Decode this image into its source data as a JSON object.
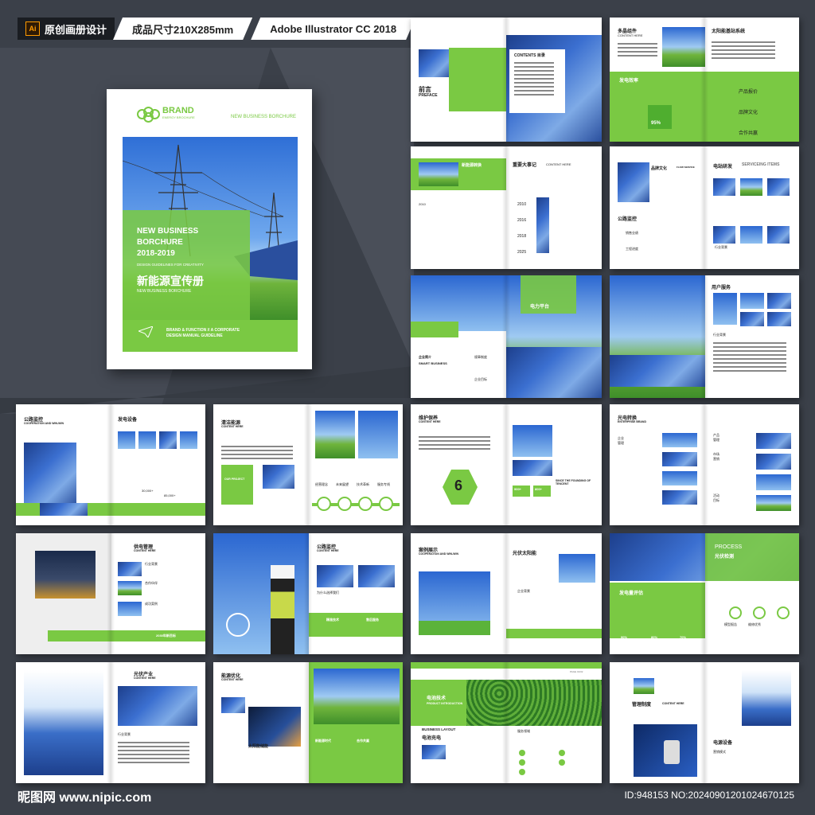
{
  "tags": {
    "software_badge": "Ai",
    "category": "原创画册设计",
    "size": "成品尺寸210X285mm",
    "software": "Adobe Illustrator CC 2018"
  },
  "cover": {
    "brand": "BRAND",
    "brand_sub": "ENERGY BROCHURE",
    "top_right": "NEW BUSINESS BORCHURE",
    "title_en_1": "NEW BUSINESS",
    "title_en_2": "BORCHURE",
    "years": "2018-2019",
    "guideline": "DESIGN GUIDELINES FOR CREATIVITY",
    "title_cn": "新能源宣传册",
    "title_cn_sub": "NEW BUSINESS BORCHURE",
    "function_1": "BRAND & FUNCTION // A CORPORATE",
    "function_2": "DESIGN MANUAL GUIDELINE"
  },
  "spreads": [
    {
      "id": "s1",
      "labels": [
        "前言",
        "PREFACE",
        "CONTENTS 目录"
      ]
    },
    {
      "id": "s2",
      "labels": [
        "多晶组件",
        "CONTENT HERE",
        "太阳能基站系统",
        "发电效率",
        "95%",
        "产品报价",
        "品牌文化",
        "合作共赢"
      ]
    },
    {
      "id": "s3",
      "labels": [
        "新能源转换",
        "重要大事记",
        "CONTENT HERE",
        "企业背景",
        "2010",
        "2016",
        "2018",
        "2025"
      ]
    },
    {
      "id": "s4",
      "labels": [
        "品牌文化",
        "FLOW SERVICE",
        "电站研发",
        "SERVICEING ITEMS",
        "公路监控",
        "行业背景",
        "销售业绩",
        "工程进度"
      ]
    },
    {
      "id": "s5",
      "labels": [
        "电力平台",
        "企业简介",
        "SMART BUSINESS",
        "规章制度",
        "企业目标"
      ]
    },
    {
      "id": "s6",
      "labels": [
        "用户服务",
        "行业背景"
      ]
    },
    {
      "id": "s7",
      "labels": [
        "公路监控",
        "COOPERATION AND WIN-WIN",
        "发电设备",
        "30,000+",
        "85,000+"
      ]
    },
    {
      "id": "s8",
      "labels": [
        "清洁能源",
        "CONTENT HERE",
        "OUR PROJECT",
        "经营理念",
        "未来展望",
        "技术革新",
        "服务专线"
      ]
    },
    {
      "id": "s9",
      "labels": [
        "维护保养",
        "CONTENT HERE",
        "6",
        "SINCE THE FOUNDING OF TENCENT",
        "900+",
        "800+"
      ]
    },
    {
      "id": "s10",
      "labels": [
        "光电转换",
        "ENTERPRISE BRAND",
        "企业管理",
        "产品管理",
        "市场营销",
        "活动目标"
      ]
    },
    {
      "id": "s11",
      "labels": [
        "供电管理",
        "CONTENT HERE",
        "行业背景",
        "合作伙伴",
        "成功案例",
        "2030年新目标"
      ]
    },
    {
      "id": "s12",
      "labels": [
        "公路监控",
        "CONTENT HERE",
        "产业发展",
        "为什么选择我们",
        "精准技术",
        "售后服务"
      ]
    },
    {
      "id": "s13",
      "labels": [
        "案例展示",
        "COOPERATION AND WIN-WIN",
        "光伏太阳能",
        "企业背景"
      ]
    },
    {
      "id": "s14",
      "labels": [
        "PROCESS",
        "光伏检测",
        "发电量评估",
        "90%",
        "80%",
        "70%",
        "模型报告",
        "维修优秀"
      ]
    },
    {
      "id": "s15",
      "labels": [
        "光伏产业",
        "CONTENT HERE",
        "行业背景"
      ]
    },
    {
      "id": "s16",
      "labels": [
        "能源优化",
        "CONTENT HERE",
        "太阳能储能",
        "新能源时代",
        "合作共赢"
      ]
    },
    {
      "id": "s17",
      "labels": [
        "电池技术",
        "PRODUCT INTRODUCTION",
        "BUSINESS LAYOUT",
        "电池充电",
        "服务领域",
        "PAGE 01/02"
      ]
    },
    {
      "id": "s18",
      "labels": [
        "管理制度",
        "CONTENT HERE",
        "电源设备",
        "营销模式"
      ]
    }
  ],
  "watermark": {
    "site": "昵图网 www.nipic.com",
    "id": "ID:948153 NO:20240901201024670125"
  },
  "colors": {
    "accent": "#7ac943",
    "background": "#3b4049"
  }
}
